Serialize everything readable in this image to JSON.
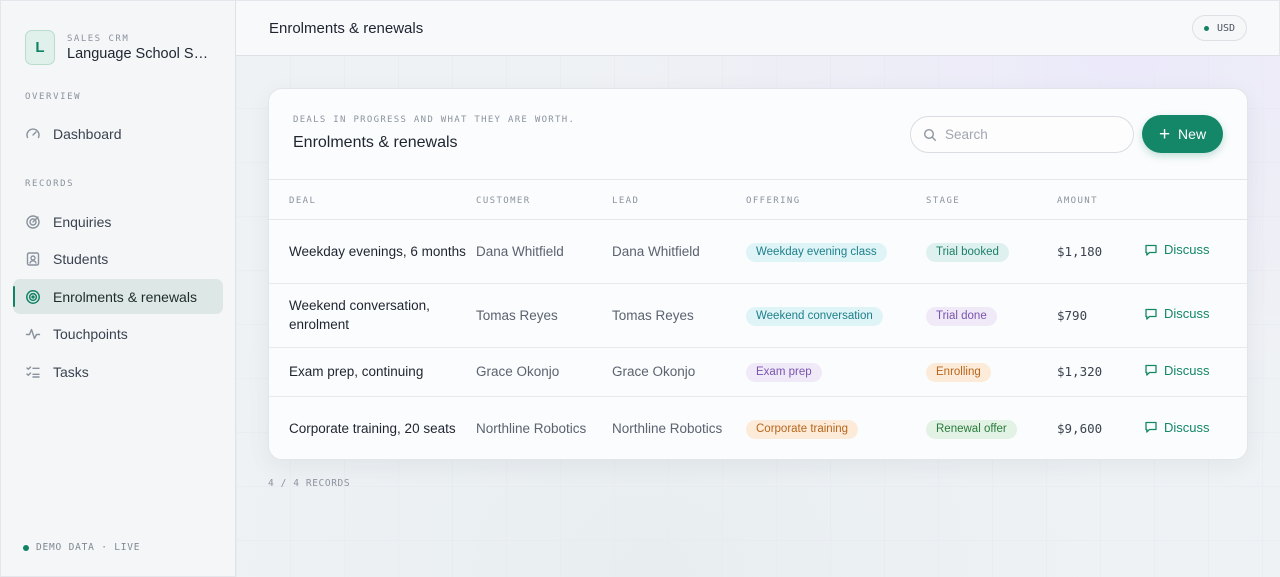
{
  "brand": {
    "logo_letter": "L",
    "kicker": "SALES CRM",
    "name": "Language School Sales"
  },
  "sidebar": {
    "overview_label": "OVERVIEW",
    "records_label": "RECORDS",
    "overview_items": [
      {
        "label": "Dashboard",
        "icon": "gauge-icon"
      }
    ],
    "record_items": [
      {
        "label": "Enquiries",
        "icon": "target-icon"
      },
      {
        "label": "Students",
        "icon": "id-card-icon"
      },
      {
        "label": "Enrolments & renewals",
        "icon": "bullseye-icon",
        "active": true
      },
      {
        "label": "Touchpoints",
        "icon": "activity-icon"
      },
      {
        "label": "Tasks",
        "icon": "checklist-icon"
      }
    ],
    "footer": "DEMO DATA · LIVE"
  },
  "topbar": {
    "title": "Enrolments & renewals",
    "currency": "USD"
  },
  "card": {
    "kicker": "DEALS IN PROGRESS AND WHAT THEY ARE WORTH.",
    "title": "Enrolments & renewals",
    "search_placeholder": "Search",
    "new_label": "New"
  },
  "table": {
    "columns": [
      "DEAL",
      "CUSTOMER",
      "LEAD",
      "OFFERING",
      "STAGE",
      "AMOUNT"
    ],
    "rows": [
      {
        "deal": "Weekday evenings, 6 months",
        "customer": "Dana Whitfield",
        "lead": "Dana Whitfield",
        "offering": "Weekday evening class",
        "stage": "Trial booked",
        "amount": "$1,180",
        "action": "Discuss"
      },
      {
        "deal": "Weekend conversation, enrolment",
        "customer": "Tomas Reyes",
        "lead": "Tomas Reyes",
        "offering": "Weekend conversation",
        "stage": "Trial done",
        "amount": "$790",
        "action": "Discuss"
      },
      {
        "deal": "Exam prep, continuing",
        "customer": "Grace Okonjo",
        "lead": "Grace Okonjo",
        "offering": "Exam prep",
        "stage": "Enrolling",
        "amount": "$1,320",
        "action": "Discuss"
      },
      {
        "deal": "Corporate training, 20 seats",
        "customer": "Northline Robotics",
        "lead": "Northline Robotics",
        "offering": "Corporate training",
        "stage": "Renewal offer",
        "amount": "$9,600",
        "action": "Discuss"
      }
    ]
  },
  "records_count": "4 / 4 RECORDS",
  "colors": {
    "accent": "#138767",
    "tag_cyan": "#dff4f6",
    "tag_purple": "#efe9f8",
    "tag_orange": "#fdebd9",
    "tag_teal": "#dff1ee",
    "tag_green": "#e2f2e4"
  }
}
